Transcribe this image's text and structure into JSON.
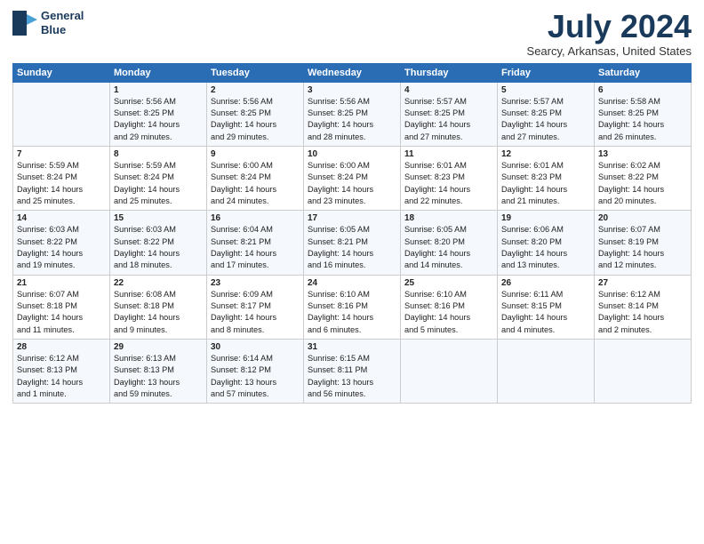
{
  "logo": {
    "line1": "General",
    "line2": "Blue"
  },
  "title": "July 2024",
  "subtitle": "Searcy, Arkansas, United States",
  "days_header": [
    "Sunday",
    "Monday",
    "Tuesday",
    "Wednesday",
    "Thursday",
    "Friday",
    "Saturday"
  ],
  "weeks": [
    [
      {
        "day": "",
        "info": ""
      },
      {
        "day": "1",
        "info": "Sunrise: 5:56 AM\nSunset: 8:25 PM\nDaylight: 14 hours\nand 29 minutes."
      },
      {
        "day": "2",
        "info": "Sunrise: 5:56 AM\nSunset: 8:25 PM\nDaylight: 14 hours\nand 29 minutes."
      },
      {
        "day": "3",
        "info": "Sunrise: 5:56 AM\nSunset: 8:25 PM\nDaylight: 14 hours\nand 28 minutes."
      },
      {
        "day": "4",
        "info": "Sunrise: 5:57 AM\nSunset: 8:25 PM\nDaylight: 14 hours\nand 27 minutes."
      },
      {
        "day": "5",
        "info": "Sunrise: 5:57 AM\nSunset: 8:25 PM\nDaylight: 14 hours\nand 27 minutes."
      },
      {
        "day": "6",
        "info": "Sunrise: 5:58 AM\nSunset: 8:25 PM\nDaylight: 14 hours\nand 26 minutes."
      }
    ],
    [
      {
        "day": "7",
        "info": "Sunrise: 5:59 AM\nSunset: 8:24 PM\nDaylight: 14 hours\nand 25 minutes."
      },
      {
        "day": "8",
        "info": "Sunrise: 5:59 AM\nSunset: 8:24 PM\nDaylight: 14 hours\nand 25 minutes."
      },
      {
        "day": "9",
        "info": "Sunrise: 6:00 AM\nSunset: 8:24 PM\nDaylight: 14 hours\nand 24 minutes."
      },
      {
        "day": "10",
        "info": "Sunrise: 6:00 AM\nSunset: 8:24 PM\nDaylight: 14 hours\nand 23 minutes."
      },
      {
        "day": "11",
        "info": "Sunrise: 6:01 AM\nSunset: 8:23 PM\nDaylight: 14 hours\nand 22 minutes."
      },
      {
        "day": "12",
        "info": "Sunrise: 6:01 AM\nSunset: 8:23 PM\nDaylight: 14 hours\nand 21 minutes."
      },
      {
        "day": "13",
        "info": "Sunrise: 6:02 AM\nSunset: 8:22 PM\nDaylight: 14 hours\nand 20 minutes."
      }
    ],
    [
      {
        "day": "14",
        "info": "Sunrise: 6:03 AM\nSunset: 8:22 PM\nDaylight: 14 hours\nand 19 minutes."
      },
      {
        "day": "15",
        "info": "Sunrise: 6:03 AM\nSunset: 8:22 PM\nDaylight: 14 hours\nand 18 minutes."
      },
      {
        "day": "16",
        "info": "Sunrise: 6:04 AM\nSunset: 8:21 PM\nDaylight: 14 hours\nand 17 minutes."
      },
      {
        "day": "17",
        "info": "Sunrise: 6:05 AM\nSunset: 8:21 PM\nDaylight: 14 hours\nand 16 minutes."
      },
      {
        "day": "18",
        "info": "Sunrise: 6:05 AM\nSunset: 8:20 PM\nDaylight: 14 hours\nand 14 minutes."
      },
      {
        "day": "19",
        "info": "Sunrise: 6:06 AM\nSunset: 8:20 PM\nDaylight: 14 hours\nand 13 minutes."
      },
      {
        "day": "20",
        "info": "Sunrise: 6:07 AM\nSunset: 8:19 PM\nDaylight: 14 hours\nand 12 minutes."
      }
    ],
    [
      {
        "day": "21",
        "info": "Sunrise: 6:07 AM\nSunset: 8:18 PM\nDaylight: 14 hours\nand 11 minutes."
      },
      {
        "day": "22",
        "info": "Sunrise: 6:08 AM\nSunset: 8:18 PM\nDaylight: 14 hours\nand 9 minutes."
      },
      {
        "day": "23",
        "info": "Sunrise: 6:09 AM\nSunset: 8:17 PM\nDaylight: 14 hours\nand 8 minutes."
      },
      {
        "day": "24",
        "info": "Sunrise: 6:10 AM\nSunset: 8:16 PM\nDaylight: 14 hours\nand 6 minutes."
      },
      {
        "day": "25",
        "info": "Sunrise: 6:10 AM\nSunset: 8:16 PM\nDaylight: 14 hours\nand 5 minutes."
      },
      {
        "day": "26",
        "info": "Sunrise: 6:11 AM\nSunset: 8:15 PM\nDaylight: 14 hours\nand 4 minutes."
      },
      {
        "day": "27",
        "info": "Sunrise: 6:12 AM\nSunset: 8:14 PM\nDaylight: 14 hours\nand 2 minutes."
      }
    ],
    [
      {
        "day": "28",
        "info": "Sunrise: 6:12 AM\nSunset: 8:13 PM\nDaylight: 14 hours\nand 1 minute."
      },
      {
        "day": "29",
        "info": "Sunrise: 6:13 AM\nSunset: 8:13 PM\nDaylight: 13 hours\nand 59 minutes."
      },
      {
        "day": "30",
        "info": "Sunrise: 6:14 AM\nSunset: 8:12 PM\nDaylight: 13 hours\nand 57 minutes."
      },
      {
        "day": "31",
        "info": "Sunrise: 6:15 AM\nSunset: 8:11 PM\nDaylight: 13 hours\nand 56 minutes."
      },
      {
        "day": "",
        "info": ""
      },
      {
        "day": "",
        "info": ""
      },
      {
        "day": "",
        "info": ""
      }
    ]
  ]
}
